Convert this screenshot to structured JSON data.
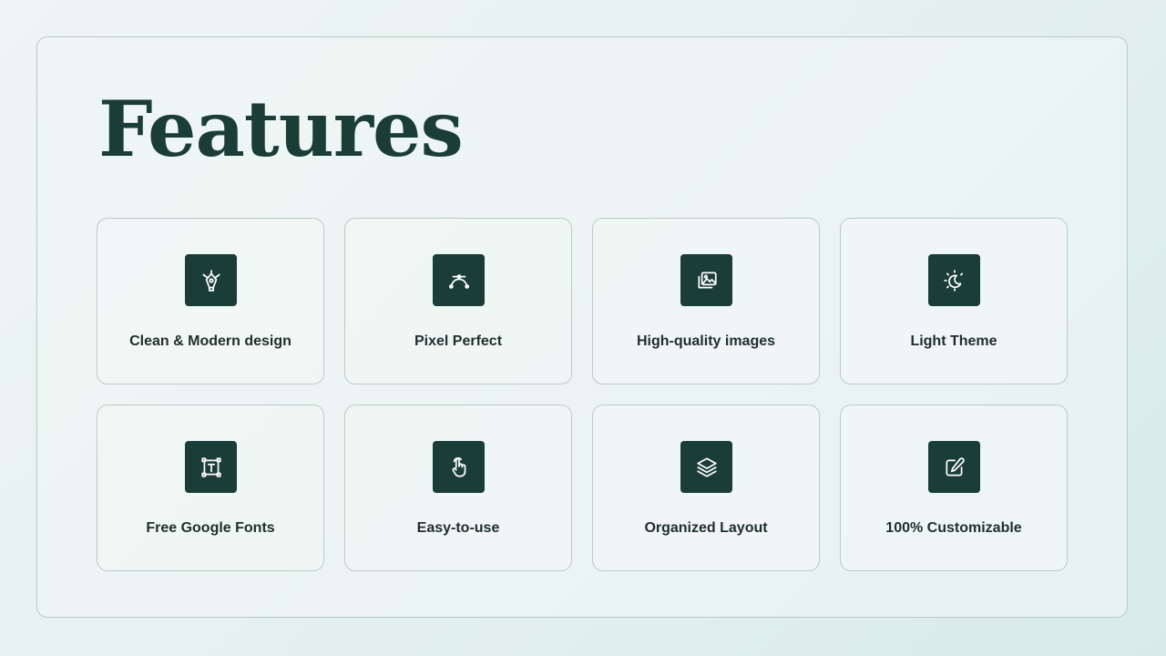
{
  "title": "Features",
  "features": [
    {
      "label": "Clean & Modern design",
      "icon": "pen-tool-icon"
    },
    {
      "label": "Pixel Perfect",
      "icon": "bezier-curve-icon"
    },
    {
      "label": "High-quality images",
      "icon": "images-icon"
    },
    {
      "label": "Light Theme",
      "icon": "sun-moon-icon"
    },
    {
      "label": "Free Google Fonts",
      "icon": "text-box-icon"
    },
    {
      "label": "Easy-to-use",
      "icon": "tap-hand-icon"
    },
    {
      "label": "Organized Layout",
      "icon": "layers-icon"
    },
    {
      "label": "100% Customizable",
      "icon": "edit-icon"
    }
  ],
  "colors": {
    "heading": "#1b3d38",
    "icon_background": "#1b3d38",
    "card_border": "#b9cbc9",
    "label": "#1f2e2c"
  }
}
